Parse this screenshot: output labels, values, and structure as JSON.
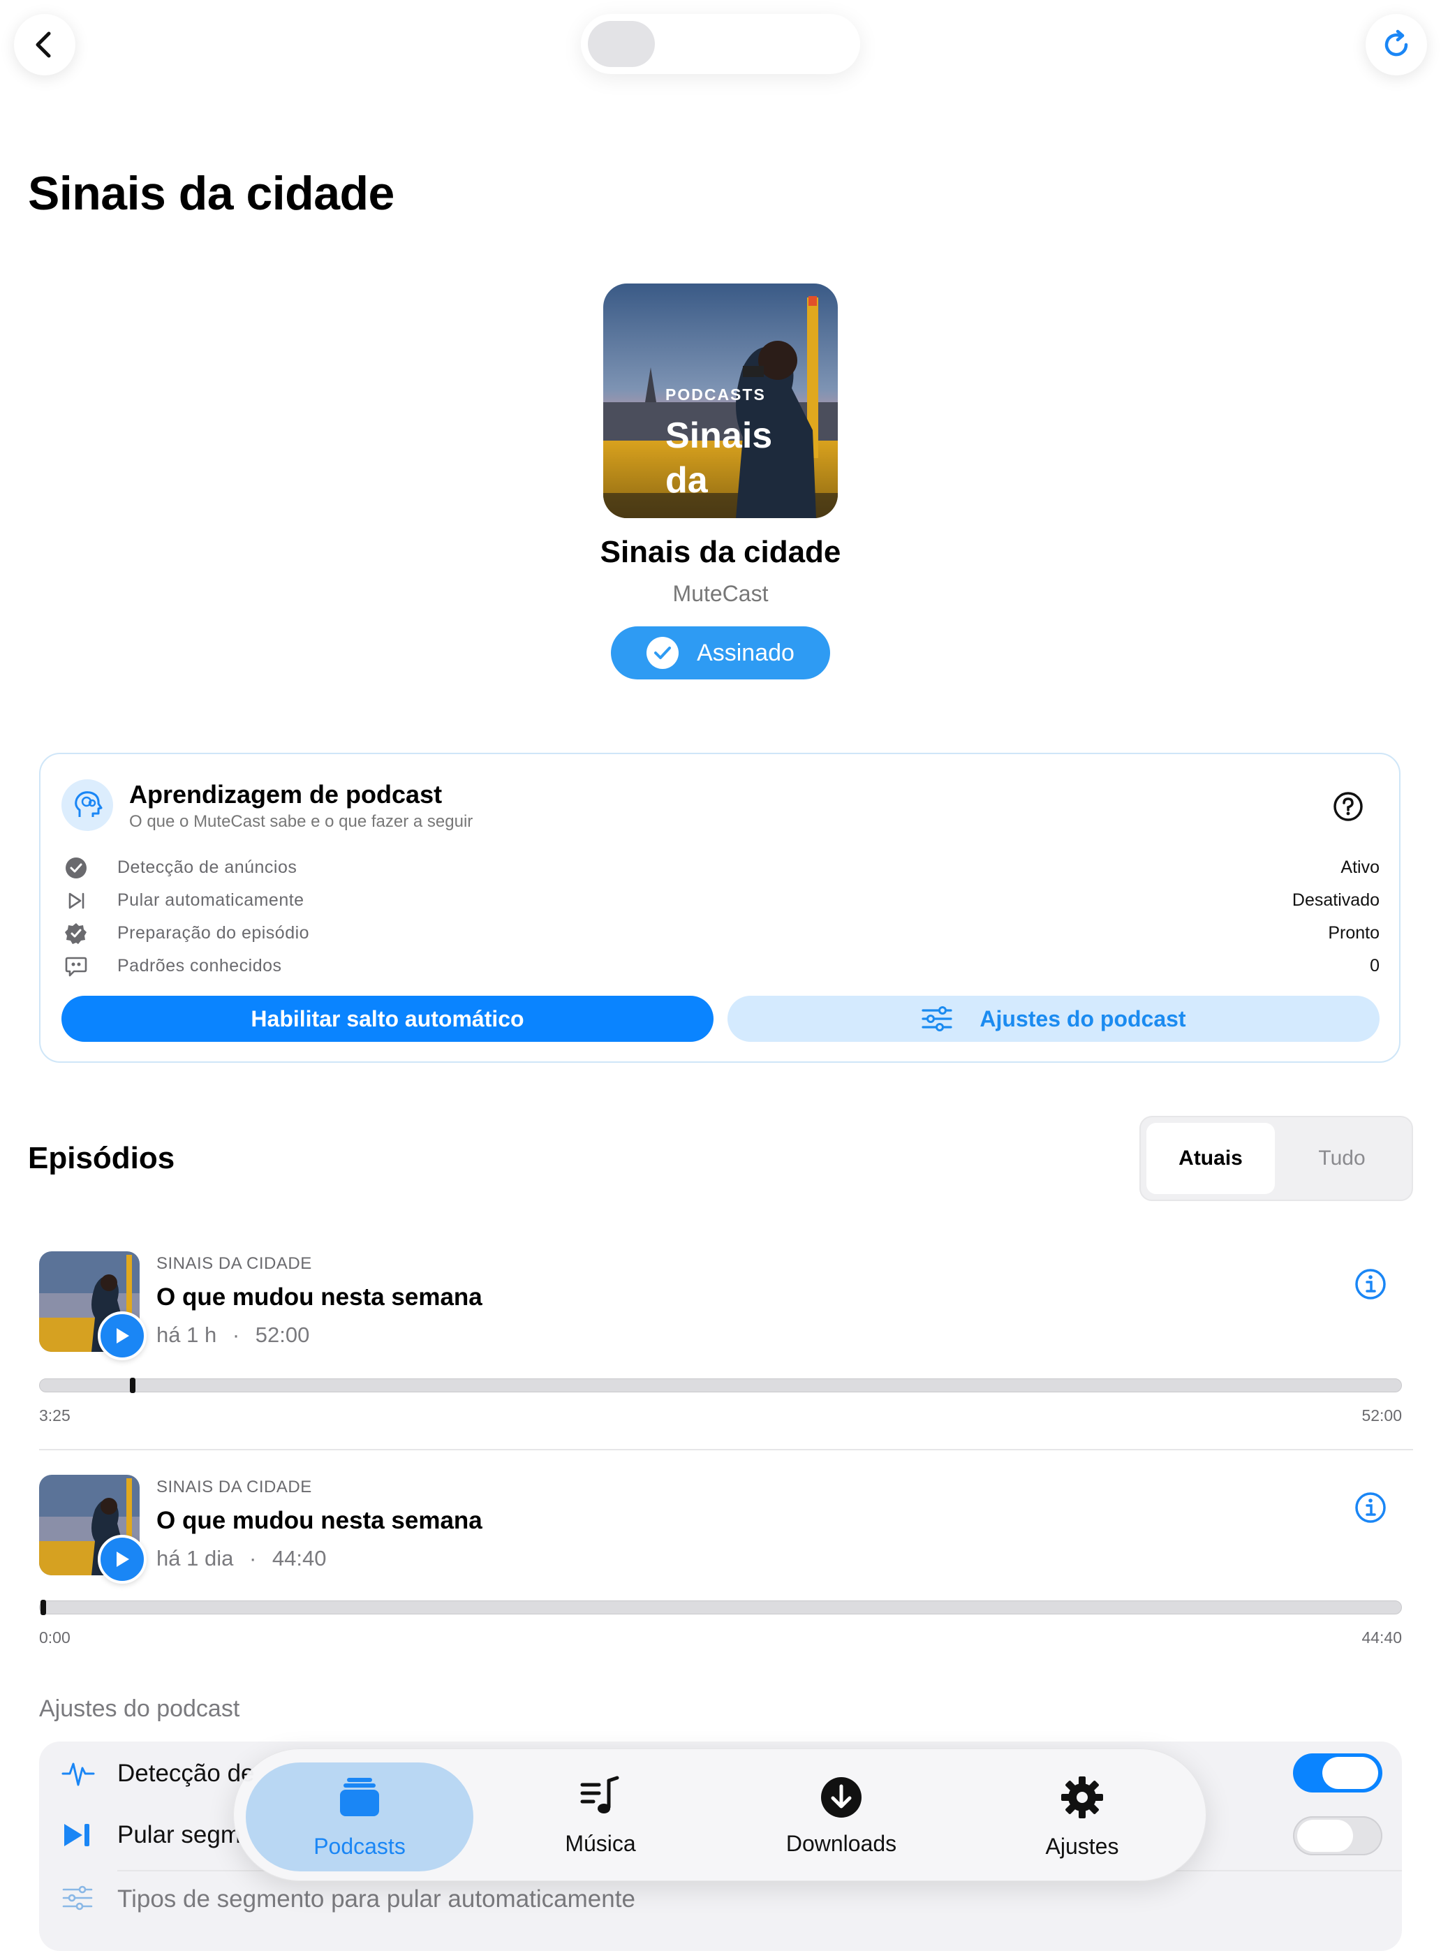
{
  "header": {
    "back_icon": "chevron-left-icon",
    "refresh_icon": "refresh-icon"
  },
  "page": {
    "title": "Sinais da cidade"
  },
  "podcast": {
    "artwork_small": "PODCASTS",
    "artwork_big": "Sinais da",
    "title": "Sinais da cidade",
    "author": "MuteCast",
    "subscribe_label": "Assinado"
  },
  "learning": {
    "title": "Aprendizagem de podcast",
    "subtitle": "O que o MuteCast sabe e o que fazer a seguir",
    "stats": [
      {
        "icon": "check-circle-icon",
        "label": "Detecção de anúncios",
        "value": "Ativo"
      },
      {
        "icon": "skip-forward-icon",
        "label": "Pular automaticamente",
        "value": "Desativado"
      },
      {
        "icon": "check-seal-icon",
        "label": "Preparação do episódio",
        "value": "Pronto"
      },
      {
        "icon": "quote-bubble-icon",
        "label": "Padrões conhecidos",
        "value": "0"
      }
    ],
    "primary_button": "Habilitar salto automático",
    "secondary_button": "Ajustes do podcast"
  },
  "episodes": {
    "title": "Episódios",
    "filters": [
      "Atuais",
      "Tudo"
    ],
    "selected_filter": "Atuais",
    "items": [
      {
        "show": "SINAIS DA CIDADE",
        "title": "O que mudou nesta semana",
        "age": "há 1 h",
        "duration": "52:00",
        "elapsed": "3:25",
        "total": "52:00",
        "progress": 0.066
      },
      {
        "show": "SINAIS DA CIDADE",
        "title": "O que mudou nesta semana",
        "age": "há 1 dia",
        "duration": "44:40",
        "elapsed": "0:00",
        "total": "44:40",
        "progress": 0.0
      }
    ]
  },
  "settings": {
    "title": "Ajustes do podcast",
    "rows": [
      {
        "label": "Detecção de",
        "enabled": true
      },
      {
        "label": "Pular segm",
        "enabled": false
      },
      {
        "label": "Tipos de segmento para pular automaticamente"
      }
    ]
  },
  "tabbar": {
    "tabs": [
      {
        "label": "Podcasts",
        "icon": "podcasts-stack-icon"
      },
      {
        "label": "Música",
        "icon": "music-list-icon"
      },
      {
        "label": "Downloads",
        "icon": "download-circle-icon"
      },
      {
        "label": "Ajustes",
        "icon": "gear-icon"
      }
    ],
    "active": "Podcasts"
  },
  "colors": {
    "accent": "#0a84ff",
    "accent_light": "#d4eafe",
    "subscribed": "#2e9bf3"
  }
}
